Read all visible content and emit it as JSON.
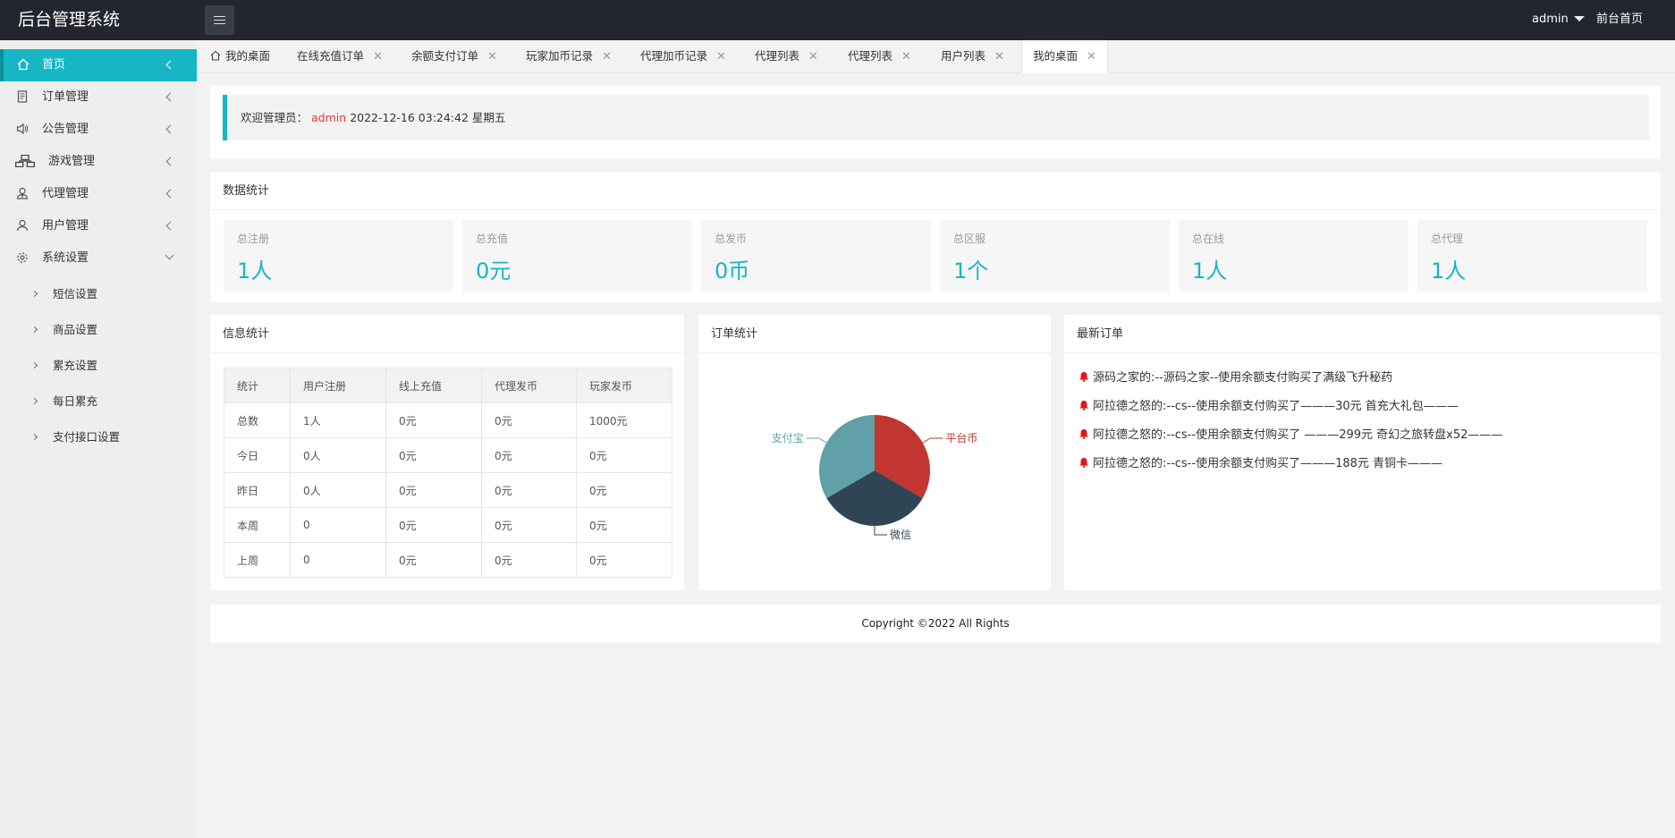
{
  "header": {
    "title": "后台管理系统",
    "user": "admin",
    "home_link": "前台首页"
  },
  "sidebar": {
    "items": [
      {
        "label": "首页",
        "icon": "home-icon"
      },
      {
        "label": "订单管理",
        "icon": "document-icon"
      },
      {
        "label": "公告管理",
        "icon": "speaker-icon"
      },
      {
        "label": "游戏管理",
        "icon": "sitemap-icon"
      },
      {
        "label": "代理管理",
        "icon": "agent-icon"
      },
      {
        "label": "用户管理",
        "icon": "user-icon"
      },
      {
        "label": "系统设置",
        "icon": "gear-icon"
      }
    ],
    "sub_items": [
      "短信设置",
      "商品设置",
      "累充设置",
      "每日累充",
      "支付接口设置"
    ]
  },
  "tabs": [
    "我的桌面",
    "在线充值订单",
    "余额支付订单",
    "玩家加币记录",
    "代理加币记录",
    "代理列表",
    "代理列表",
    "用户列表",
    "我的桌面"
  ],
  "welcome": {
    "prefix": "欢迎管理员：",
    "user": "admin",
    "datetime": "2022-12-16  03:24:42  星期五"
  },
  "stats": {
    "title": "数据统计",
    "boxes": [
      {
        "label": "总注册",
        "value": "1人"
      },
      {
        "label": "总充值",
        "value": "0元"
      },
      {
        "label": "总发币",
        "value": "0币"
      },
      {
        "label": "总区服",
        "value": "1个"
      },
      {
        "label": "总在线",
        "value": "1人"
      },
      {
        "label": "总代理",
        "value": "1人"
      }
    ]
  },
  "info": {
    "title": "信息统计",
    "headers": [
      "统计",
      "用户注册",
      "线上充值",
      "代理发币",
      "玩家发币"
    ],
    "rows": [
      [
        "总数",
        "1人",
        "0元",
        "0元",
        "1000元"
      ],
      [
        "今日",
        "0人",
        "0元",
        "0元",
        "0元"
      ],
      [
        "昨日",
        "0人",
        "0元",
        "0元",
        "0元"
      ],
      [
        "本周",
        "0",
        "0元",
        "0元",
        "0元"
      ],
      [
        "上周",
        "0",
        "0元",
        "0元",
        "0元"
      ]
    ]
  },
  "order_stats": {
    "title": "订单统计"
  },
  "chart_data": {
    "type": "pie",
    "slices": [
      {
        "label": "平台币",
        "value": 1,
        "color": "#c23531"
      },
      {
        "label": "微信",
        "value": 1,
        "color": "#2f4554"
      },
      {
        "label": "支付宝",
        "value": 1,
        "color": "#61a0a8"
      }
    ]
  },
  "latest": {
    "title": "最新订单",
    "items": [
      "源码之家的:--源码之家--使用余额支付购买了满级飞升秘药",
      "阿拉德之怒的:--cs--使用余额支付购买了———30元 首充大礼包———",
      "阿拉德之怒的:--cs--使用余额支付购买了 ———299元 奇幻之旅转盘x52———",
      "阿拉德之怒的:--cs--使用余额支付购买了———188元 青铜卡———"
    ]
  },
  "footer": {
    "copyright": "Copyright ©2022 All Rights"
  },
  "colors": {
    "accent": "#16b6c5",
    "header_bg": "#23262e",
    "highlight_red": "#e4393c"
  }
}
